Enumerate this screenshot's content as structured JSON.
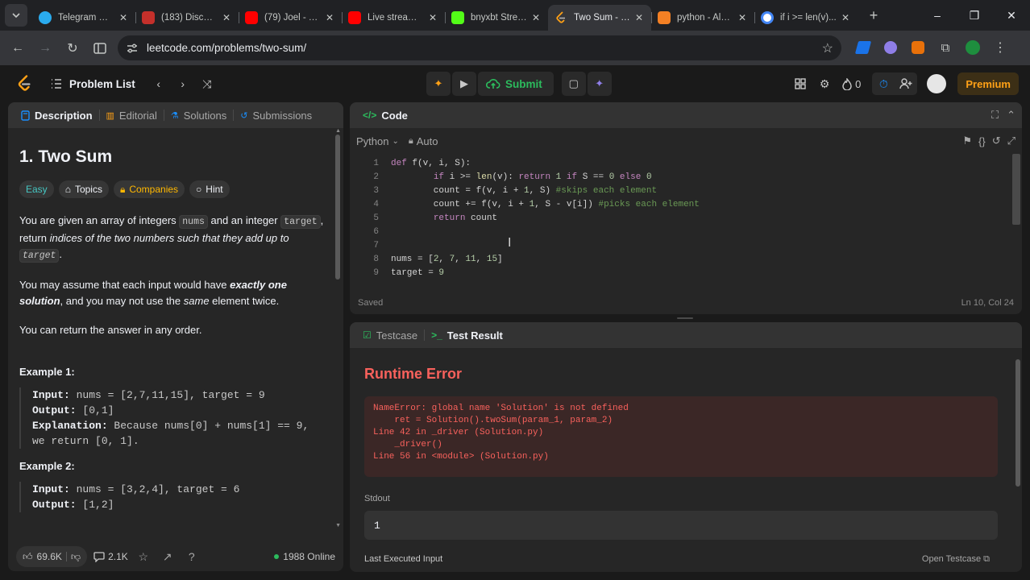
{
  "browser": {
    "tabs": [
      {
        "label": "Telegram W...",
        "color": "#2aabee",
        "active": false
      },
      {
        "label": "(183) Discor...",
        "color": "#c4302b",
        "active": false
      },
      {
        "label": "(79) Joel - Yo...",
        "color": "#ff0000",
        "active": false
      },
      {
        "label": "Live streami...",
        "color": "#ff0000",
        "active": false
      },
      {
        "label": "bnyxbt Strea...",
        "color": "#53fc18",
        "active": false
      },
      {
        "label": "Two Sum - L...",
        "color": "#ffa116",
        "active": true
      },
      {
        "label": "python - Alg...",
        "color": "#f48024",
        "active": false
      },
      {
        "label": "if i >= len(v)...",
        "color": "#4285f4",
        "active": false
      }
    ],
    "url": "leetcode.com/problems/two-sum/"
  },
  "nav": {
    "problem_list": "Problem List",
    "submit": "Submit",
    "fire_count": "0",
    "premium": "Premium"
  },
  "description": {
    "tabs": [
      "Description",
      "Editorial",
      "Solutions",
      "Submissions"
    ],
    "title": "1. Two Sum",
    "tags": {
      "difficulty": "Easy",
      "topics": "Topics",
      "companies": "Companies",
      "hint": "Hint"
    },
    "p1_a": "You are given an array of integers ",
    "p1_code1": "nums",
    "p1_b": " and an integer ",
    "p1_code2": "target",
    "p1_c": ", return ",
    "p1_em": "indices of the two numbers such that they add up to",
    "p1_code3": "target",
    "p1_d": ".",
    "p2_a": "You may assume that each input would have ",
    "p2_em": "exactly one solution",
    "p2_b": ", and you may not use the ",
    "p2_em2": "same",
    "p2_c": " element twice.",
    "p3": "You can return the answer in any order.",
    "example1_h": "Example 1:",
    "example1": {
      "input_label": "Input:",
      "input": " nums = [2,7,11,15], target = 9",
      "output_label": "Output:",
      "output": " [0,1]",
      "expl_label": "Explanation:",
      "expl": " Because nums[0] + nums[1] == 9,",
      "expl2": "we return [0, 1]."
    },
    "example2_h": "Example 2:",
    "example2": {
      "input_label": "Input:",
      "input": " nums = [3,2,4], target = 6",
      "output_label": "Output:",
      "output": " [1,2]"
    },
    "footer": {
      "likes": "69.6K",
      "comments": "2.1K",
      "online": "1988 Online"
    }
  },
  "code": {
    "title": "Code",
    "language": "Python",
    "mode": "Auto",
    "lines": [
      {
        "n": "1",
        "t": "def f(v, i, S):"
      },
      {
        "n": "2",
        "t": "        if i >= len(v): return 1 if S == 0 else 0"
      },
      {
        "n": "3",
        "t": "        count = f(v, i + 1, S) #skips each element"
      },
      {
        "n": "4",
        "t": "        count += f(v, i + 1, S - v[i]) #picks each element"
      },
      {
        "n": "5",
        "t": "        return count"
      },
      {
        "n": "6",
        "t": ""
      },
      {
        "n": "7",
        "t": ""
      },
      {
        "n": "8",
        "t": "nums = [2, 7, 11, 15]"
      },
      {
        "n": "9",
        "t": "target = 9"
      }
    ],
    "status": "Saved",
    "position": "Ln 10, Col 24"
  },
  "test": {
    "tabs": [
      "Testcase",
      "Test Result"
    ],
    "title": "Runtime Error",
    "error": "NameError: global name 'Solution' is not defined\n    ret = Solution().twoSum(param_1, param_2)\nLine 42 in _driver (Solution.py)\n    _driver()\nLine 56 in <module> (Solution.py)",
    "stdout_label": "Stdout",
    "stdout": "1",
    "last_input_label": "Last Executed Input",
    "open_testcase": "Open Testcase"
  },
  "colors": {
    "accent": "#ffa116",
    "submit": "#2cbb5d",
    "error": "#f8615c"
  }
}
